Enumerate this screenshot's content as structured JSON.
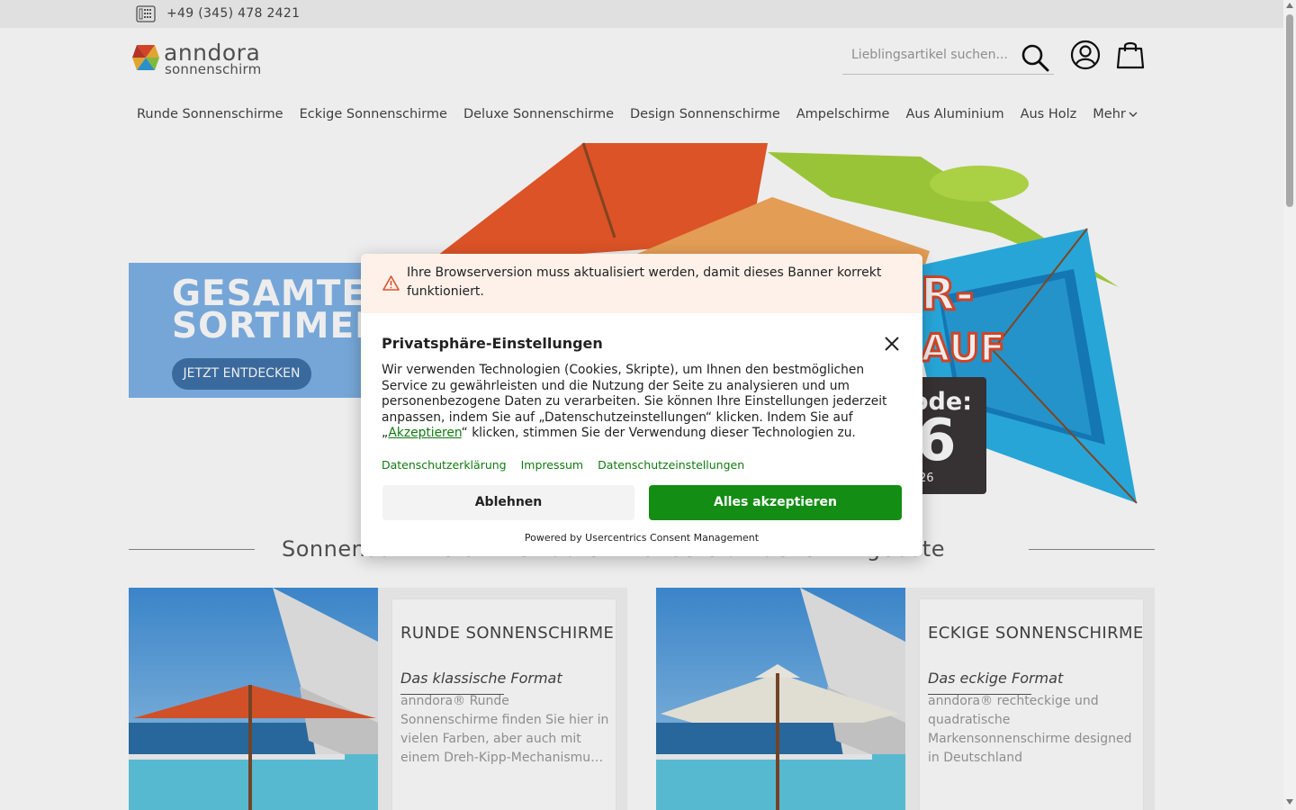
{
  "topbar": {
    "phone": "+49 (345) 478 2421"
  },
  "header": {
    "logo_word1": "anndora",
    "logo_word2": "sonnenschirm",
    "search_placeholder": "Lieblingsartikel suchen..."
  },
  "nav": {
    "items": [
      "Runde Sonnenschirme",
      "Eckige Sonnenschirme",
      "Deluxe Sonnenschirme",
      "Design Sonnenschirme",
      "Ampelschirme",
      "Aus Aluminium",
      "Aus Holz",
      "Mehr"
    ]
  },
  "hero": {
    "title_line1": "GESAMTES",
    "title_line2": "SORTIMENT",
    "cta": "JETZT ENTDECKEN",
    "promo_fragment_1": "R-",
    "promo_fragment_2": "AUF",
    "promo_fragment_3": "ode:",
    "promo_fragment_4": "6",
    "promo_fragment_5": "26"
  },
  "section": {
    "heading": "Sonnenschirme online kaufen – Unsere aktuellen Angebote"
  },
  "cards": [
    {
      "title": "RUNDE SONNENSCHIRME",
      "subtitle": "Das klassische Format",
      "description": "anndora® Runde Sonnenschirme finden Sie hier in vielen Farben, aber auch mit einem Dreh-Kipp-Mechanismu…"
    },
    {
      "title": "ECKIGE SONNENSCHIRME",
      "subtitle": "Das eckige Format",
      "description": "anndora® rechteckige und quadratische Markensonnenschirme designed in Deutschland"
    }
  ],
  "consent": {
    "warning": "Ihre Browserversion muss aktualisiert werden, damit dieses Banner korrekt funktioniert.",
    "title": "Privatsphäre-Einstellungen",
    "body_part1": "Wir verwenden Technologien (Cookies, Skripte), um Ihnen den bestmöglichen Service zu gewährleisten und die Nutzung der Seite zu analysieren und um personenbezogene Daten zu verarbeiten. Sie können Ihre Einstellungen jederzeit anpassen, indem Sie auf „Datenschutzeinstellungen“ klicken. Indem Sie auf „",
    "body_link": "Akzeptieren",
    "body_part2": "“ klicken, stimmen Sie der Verwendung dieser Technologien zu.",
    "links": [
      "Datenschutzerklärung",
      "Impressum",
      "Datenschutzeinstellungen"
    ],
    "decline": "Ablehnen",
    "accept": "Alles akzeptieren",
    "powered": "Powered by Usercentrics Consent Management"
  },
  "colors": {
    "accent_green": "#138d13",
    "link_green": "#107a10",
    "hero_blue": "#7fb3e8",
    "button_blue": "#3f73a9",
    "warning_bg": "#fdf1ea",
    "warning_icon": "#e0522b"
  }
}
